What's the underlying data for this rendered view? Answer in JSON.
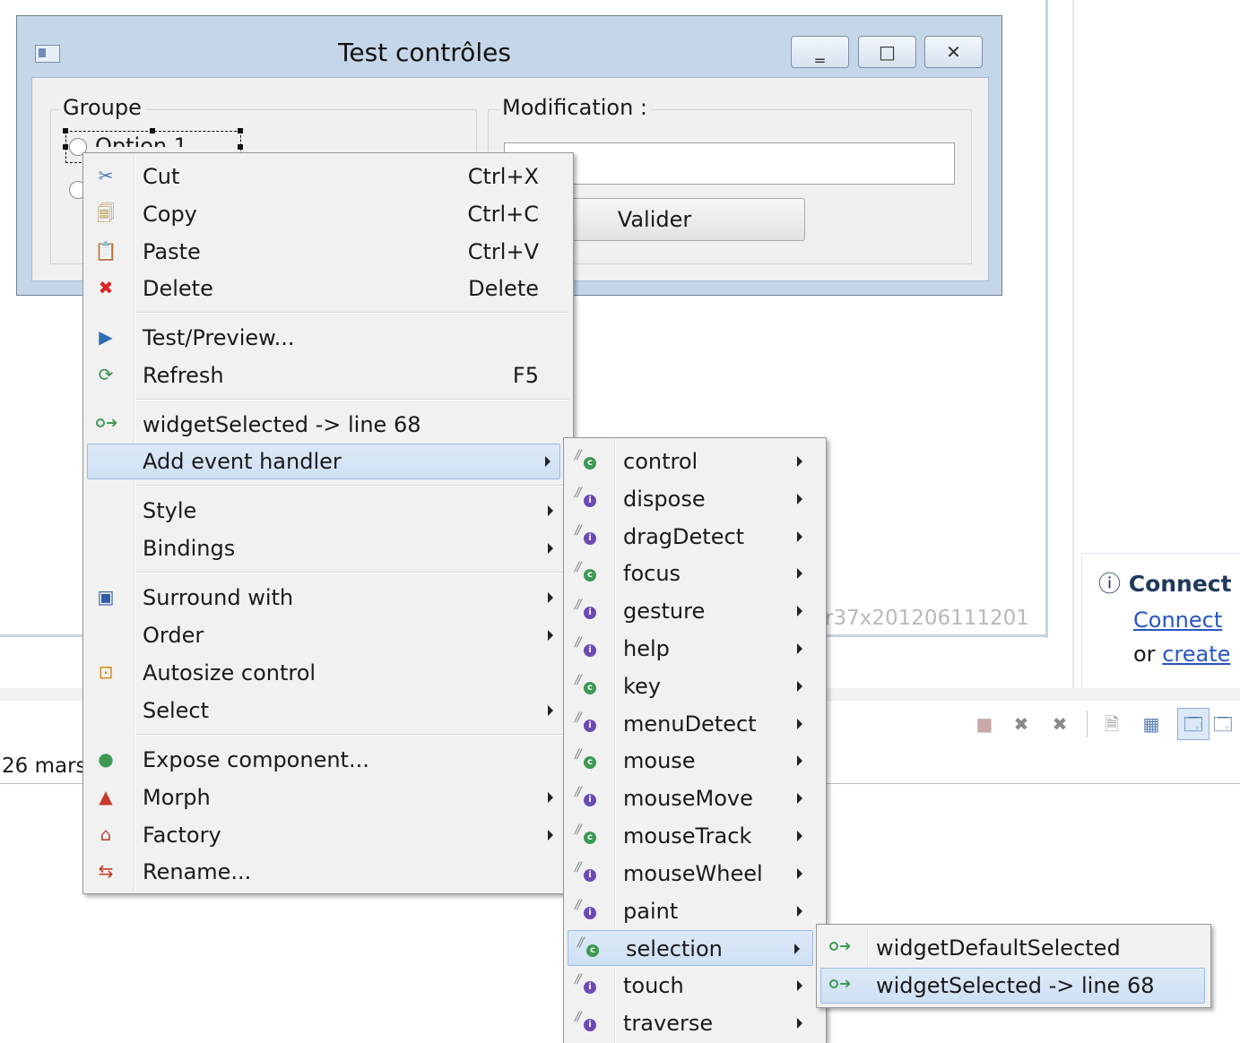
{
  "window": {
    "title": "Test contrôles",
    "controls": {
      "minimize": "‗",
      "maximize": "□",
      "close": "✕"
    },
    "group": {
      "label": "Groupe",
      "option1": "Option 1"
    },
    "modification": {
      "label": "Modification :",
      "input_value": "",
      "button": "Valider"
    }
  },
  "background": {
    "version_text": "r37x201206111201",
    "date_text": "26 mars",
    "info_panel": {
      "title": "Connect",
      "link": "Connect",
      "or_text": "or",
      "create_link": "create"
    }
  },
  "context_menu": {
    "items": [
      {
        "label": "Cut",
        "shortcut": "Ctrl+X",
        "icon": "scissors-icon"
      },
      {
        "label": "Copy",
        "shortcut": "Ctrl+C",
        "icon": "copy-icon"
      },
      {
        "label": "Paste",
        "shortcut": "Ctrl+V",
        "icon": "paste-icon"
      },
      {
        "label": "Delete",
        "shortcut": "Delete",
        "icon": "delete-icon"
      },
      {
        "label": "Test/Preview...",
        "shortcut": "",
        "icon": "preview-icon"
      },
      {
        "label": "Refresh",
        "shortcut": "F5",
        "icon": "refresh-icon"
      },
      {
        "label": "widgetSelected -> line 68",
        "shortcut": "",
        "icon": "method-icon"
      },
      {
        "label": "Add event handler",
        "shortcut": "",
        "icon": ""
      },
      {
        "label": "Style",
        "shortcut": "",
        "icon": ""
      },
      {
        "label": "Bindings",
        "shortcut": "",
        "icon": ""
      },
      {
        "label": "Surround with",
        "shortcut": "",
        "icon": "surround-icon"
      },
      {
        "label": "Order",
        "shortcut": "",
        "icon": ""
      },
      {
        "label": "Autosize control",
        "shortcut": "",
        "icon": "autosize-icon"
      },
      {
        "label": "Select",
        "shortcut": "",
        "icon": ""
      },
      {
        "label": "Expose component...",
        "shortcut": "",
        "icon": "expose-icon"
      },
      {
        "label": "Morph",
        "shortcut": "",
        "icon": "morph-icon"
      },
      {
        "label": "Factory",
        "shortcut": "",
        "icon": "factory-icon"
      },
      {
        "label": "Rename...",
        "shortcut": "",
        "icon": "rename-icon"
      }
    ]
  },
  "event_menu": {
    "items": [
      {
        "label": "control",
        "kind": "g"
      },
      {
        "label": "dispose",
        "kind": "p"
      },
      {
        "label": "dragDetect",
        "kind": "p"
      },
      {
        "label": "focus",
        "kind": "g"
      },
      {
        "label": "gesture",
        "kind": "p"
      },
      {
        "label": "help",
        "kind": "p"
      },
      {
        "label": "key",
        "kind": "g"
      },
      {
        "label": "menuDetect",
        "kind": "p"
      },
      {
        "label": "mouse",
        "kind": "g"
      },
      {
        "label": "mouseMove",
        "kind": "p"
      },
      {
        "label": "mouseTrack",
        "kind": "g"
      },
      {
        "label": "mouseWheel",
        "kind": "p"
      },
      {
        "label": "paint",
        "kind": "p"
      },
      {
        "label": "selection",
        "kind": "g"
      },
      {
        "label": "touch",
        "kind": "p"
      },
      {
        "label": "traverse",
        "kind": "p"
      }
    ]
  },
  "selection_menu": {
    "items": [
      {
        "label": "widgetDefaultSelected"
      },
      {
        "label": "widgetSelected -> line 68"
      }
    ]
  },
  "colors": {
    "menu_bg": "#f1f1f1",
    "highlight": "#cfe0f4",
    "window_frame": "#c6d6e9",
    "link": "#2a55c2"
  }
}
